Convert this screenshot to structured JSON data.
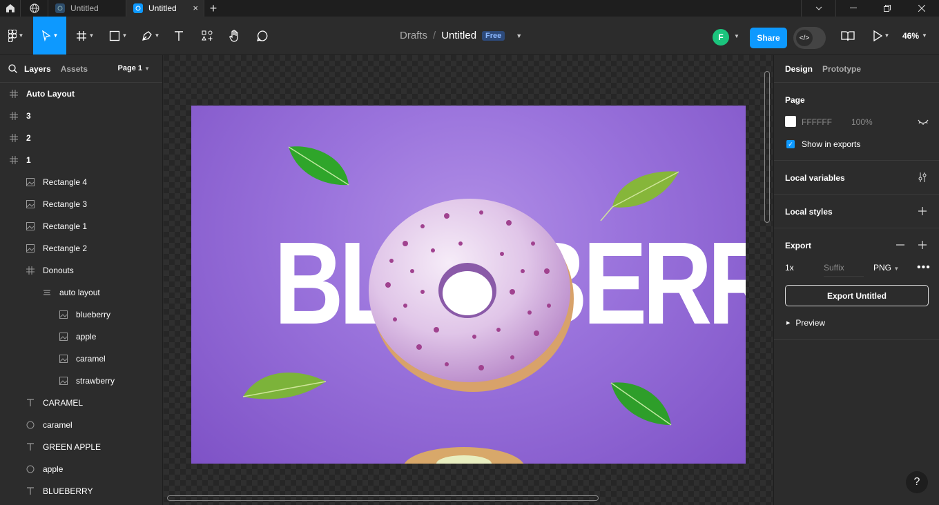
{
  "titlebar": {
    "tabs": [
      {
        "label": "Untitled",
        "active": false
      },
      {
        "label": "Untitled",
        "active": true,
        "close": "×"
      }
    ],
    "new_tab": "+"
  },
  "toolbar": {
    "breadcrumb_root": "Drafts",
    "breadcrumb_sep": "/",
    "file_name": "Untitled",
    "plan_badge": "Free",
    "avatar_initial": "F",
    "share_label": "Share",
    "zoom_level": "46%"
  },
  "left_panel": {
    "tab_layers": "Layers",
    "tab_assets": "Assets",
    "page_selector": "Page 1",
    "layers": [
      {
        "name": "Auto Layout",
        "icon": "frame-icon",
        "indent": 0,
        "bold": true
      },
      {
        "name": "3",
        "icon": "frame-icon",
        "indent": 0,
        "bold": true
      },
      {
        "name": "2",
        "icon": "frame-icon",
        "indent": 0,
        "bold": true
      },
      {
        "name": "1",
        "icon": "frame-icon",
        "indent": 0,
        "bold": true
      },
      {
        "name": "Rectangle 4",
        "icon": "image-icon",
        "indent": 1,
        "bold": false
      },
      {
        "name": "Rectangle 3",
        "icon": "image-icon",
        "indent": 1,
        "bold": false
      },
      {
        "name": "Rectangle 1",
        "icon": "image-icon",
        "indent": 1,
        "bold": false
      },
      {
        "name": "Rectangle 2",
        "icon": "image-icon",
        "indent": 1,
        "bold": false
      },
      {
        "name": "Donouts",
        "icon": "frame-icon",
        "indent": 1,
        "bold": false
      },
      {
        "name": "auto layout",
        "icon": "autolayout-icon",
        "indent": 2,
        "bold": false
      },
      {
        "name": "blueberry",
        "icon": "image-icon",
        "indent": 3,
        "bold": false
      },
      {
        "name": "apple",
        "icon": "image-icon",
        "indent": 3,
        "bold": false
      },
      {
        "name": "caramel",
        "icon": "image-icon",
        "indent": 3,
        "bold": false
      },
      {
        "name": "strawberry",
        "icon": "image-icon",
        "indent": 3,
        "bold": false
      },
      {
        "name": "CARAMEL",
        "icon": "text-icon",
        "indent": 1,
        "bold": false
      },
      {
        "name": "caramel",
        "icon": "ellipse-icon",
        "indent": 1,
        "bold": false
      },
      {
        "name": "GREEN APPLE",
        "icon": "text-icon",
        "indent": 1,
        "bold": false
      },
      {
        "name": "apple",
        "icon": "ellipse-icon",
        "indent": 1,
        "bold": false
      },
      {
        "name": "BLUEBERRY",
        "icon": "text-icon",
        "indent": 1,
        "bold": false
      }
    ]
  },
  "canvas": {
    "artboard_text": "BLUEBERRY",
    "artboard_color": "#9a73dc"
  },
  "right_panel": {
    "tab_design": "Design",
    "tab_prototype": "Prototype",
    "page_section": "Page",
    "page_color": "FFFFFF",
    "page_opacity": "100%",
    "show_in_exports": "Show in exports",
    "local_variables": "Local variables",
    "local_styles": "Local styles",
    "export_section": "Export",
    "export_scale": "1x",
    "export_suffix_placeholder": "Suffix",
    "export_format": "PNG",
    "export_button": "Export Untitled",
    "preview": "Preview"
  },
  "help_label": "?",
  "colors": {
    "accent": "#0d99ff",
    "badge_free": "#2d4a7a",
    "avatar": "#1bc47d"
  }
}
